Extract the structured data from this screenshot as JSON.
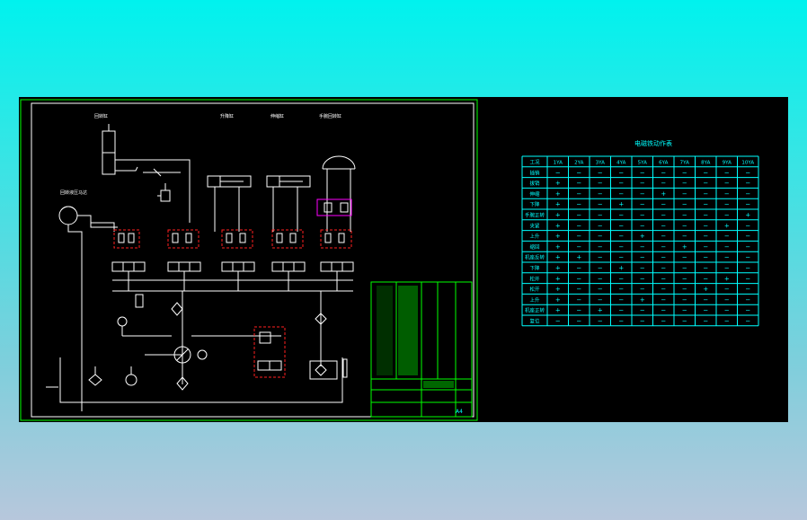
{
  "drawing": {
    "labels": {
      "rotary_cylinder": "回转缸",
      "cylinder_a": "升降缸",
      "cylinder_b": "伸缩缸",
      "cylinder_c": "手腕回转缸",
      "motor": "回转液压马达",
      "sheet_no": "A4"
    }
  },
  "table": {
    "title": "电磁铁动作表",
    "headers": [
      "工况",
      "1YA",
      "2YA",
      "3YA",
      "4YA",
      "5YA",
      "6YA",
      "7YA",
      "8YA",
      "9YA",
      "10YA"
    ],
    "rows": [
      {
        "op": "插销",
        "cells": [
          "−",
          "−",
          "−",
          "−",
          "−",
          "−",
          "−",
          "−",
          "−",
          "−"
        ]
      },
      {
        "op": "拔销",
        "cells": [
          "+",
          "−",
          "−",
          "−",
          "−",
          "−",
          "−",
          "−",
          "−",
          "−"
        ]
      },
      {
        "op": "伸缩",
        "cells": [
          "+",
          "−",
          "−",
          "−",
          "−",
          "+",
          "−",
          "−",
          "−",
          "−"
        ]
      },
      {
        "op": "下降",
        "cells": [
          "+",
          "−",
          "−",
          "+",
          "−",
          "−",
          "−",
          "−",
          "−",
          "−"
        ]
      },
      {
        "op": "手腕正转",
        "cells": [
          "+",
          "−",
          "−",
          "−",
          "−",
          "−",
          "−",
          "−",
          "−",
          "+"
        ]
      },
      {
        "op": "夹紧",
        "cells": [
          "+",
          "−",
          "−",
          "−",
          "−",
          "−",
          "−",
          "−",
          "+",
          "−"
        ]
      },
      {
        "op": "上升",
        "cells": [
          "+",
          "−",
          "−",
          "−",
          "+",
          "−",
          "−",
          "−",
          "−",
          "−"
        ]
      },
      {
        "op": "缩回",
        "cells": [
          "+",
          "−",
          "−",
          "−",
          "−",
          "−",
          "+",
          "−",
          "−",
          "−"
        ]
      },
      {
        "op": "机座反转",
        "cells": [
          "+",
          "+",
          "−",
          "−",
          "−",
          "−",
          "−",
          "−",
          "−",
          "−"
        ]
      },
      {
        "op": "下降",
        "cells": [
          "+",
          "−",
          "−",
          "+",
          "−",
          "−",
          "−",
          "−",
          "−",
          "−"
        ]
      },
      {
        "op": "松开",
        "cells": [
          "+",
          "−",
          "−",
          "−",
          "−",
          "−",
          "−",
          "−",
          "+",
          "−"
        ]
      },
      {
        "op": "松开",
        "cells": [
          "+",
          "−",
          "−",
          "−",
          "−",
          "−",
          "−",
          "+",
          "−",
          "−"
        ]
      },
      {
        "op": "上升",
        "cells": [
          "+",
          "−",
          "−",
          "−",
          "+",
          "−",
          "−",
          "−",
          "−",
          "−"
        ]
      },
      {
        "op": "机座正转",
        "cells": [
          "+",
          "−",
          "+",
          "−",
          "−",
          "−",
          "−",
          "−",
          "−",
          "−"
        ]
      },
      {
        "op": "复位",
        "cells": [
          "−",
          "−",
          "−",
          "−",
          "−",
          "−",
          "−",
          "−",
          "−",
          "−"
        ]
      }
    ]
  }
}
